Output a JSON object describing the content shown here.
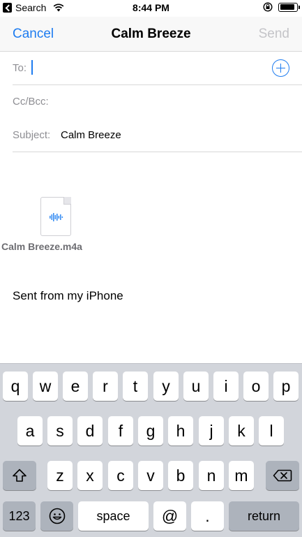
{
  "status_bar": {
    "back_app_label": "Search",
    "time": "8:44 PM"
  },
  "nav": {
    "cancel_label": "Cancel",
    "title": "Calm Breeze",
    "send_label": "Send"
  },
  "compose": {
    "to_label": "To:",
    "to_value": "",
    "cc_label": "Cc/Bcc:",
    "subject_label": "Subject:",
    "subject_value": "Calm Breeze"
  },
  "body": {
    "attachment_name": "Calm Breeze.m4a",
    "signature": "Sent from my iPhone"
  },
  "keyboard": {
    "row1": [
      "q",
      "w",
      "e",
      "r",
      "t",
      "y",
      "u",
      "i",
      "o",
      "p"
    ],
    "row2": [
      "a",
      "s",
      "d",
      "f",
      "g",
      "h",
      "j",
      "k",
      "l"
    ],
    "row3": [
      "z",
      "x",
      "c",
      "v",
      "b",
      "n",
      "m"
    ],
    "numbers_label": "123",
    "space_label": "space",
    "at_label": "@",
    "dot_label": ".",
    "return_label": "return"
  },
  "colors": {
    "accent": "#1e7cf0",
    "disabled": "#c4c4c8",
    "keyboard_bg": "#d2d5db"
  }
}
